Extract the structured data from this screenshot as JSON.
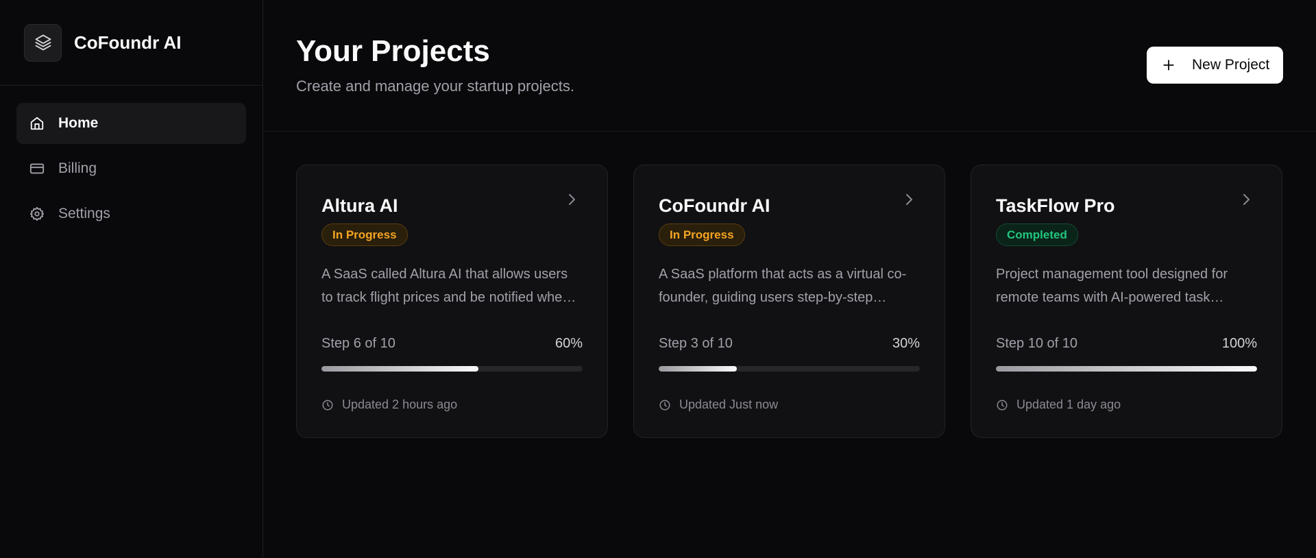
{
  "sidebar": {
    "brand": "CoFoundr AI",
    "items": [
      {
        "label": "Home",
        "icon": "home-icon",
        "active": true
      },
      {
        "label": "Billing",
        "icon": "credit-card-icon",
        "active": false
      },
      {
        "label": "Settings",
        "icon": "gear-icon",
        "active": false
      }
    ]
  },
  "header": {
    "title": "Your Projects",
    "subtitle": "Create and manage your startup projects.",
    "new_project_label": "New Project"
  },
  "projects": [
    {
      "name": "Altura AI",
      "status": "In Progress",
      "status_type": "progress",
      "description": "A SaaS called Altura AI that allows users to track flight prices and be notified when prices drop.",
      "step_text": "Step 6 of 10",
      "percent_text": "60%",
      "progress": 0.6,
      "updated": "Updated 2 hours ago"
    },
    {
      "name": "CoFoundr AI",
      "status": "In Progress",
      "status_type": "progress",
      "description": "A SaaS platform that acts as a virtual co-founder, guiding users step-by-step through building a startup.",
      "step_text": "Step 3 of 10",
      "percent_text": "30%",
      "progress": 0.3,
      "updated": "Updated Just now"
    },
    {
      "name": "TaskFlow Pro",
      "status": "Completed",
      "status_type": "done",
      "description": "Project management tool designed for remote teams with AI-powered task prioritization.",
      "step_text": "Step 10 of 10",
      "percent_text": "100%",
      "progress": 1.0,
      "updated": "Updated 1 day ago"
    }
  ],
  "colors": {
    "background": "#09090b",
    "card": "#111113",
    "in_progress": "#f5a524",
    "completed": "#22c57e"
  }
}
